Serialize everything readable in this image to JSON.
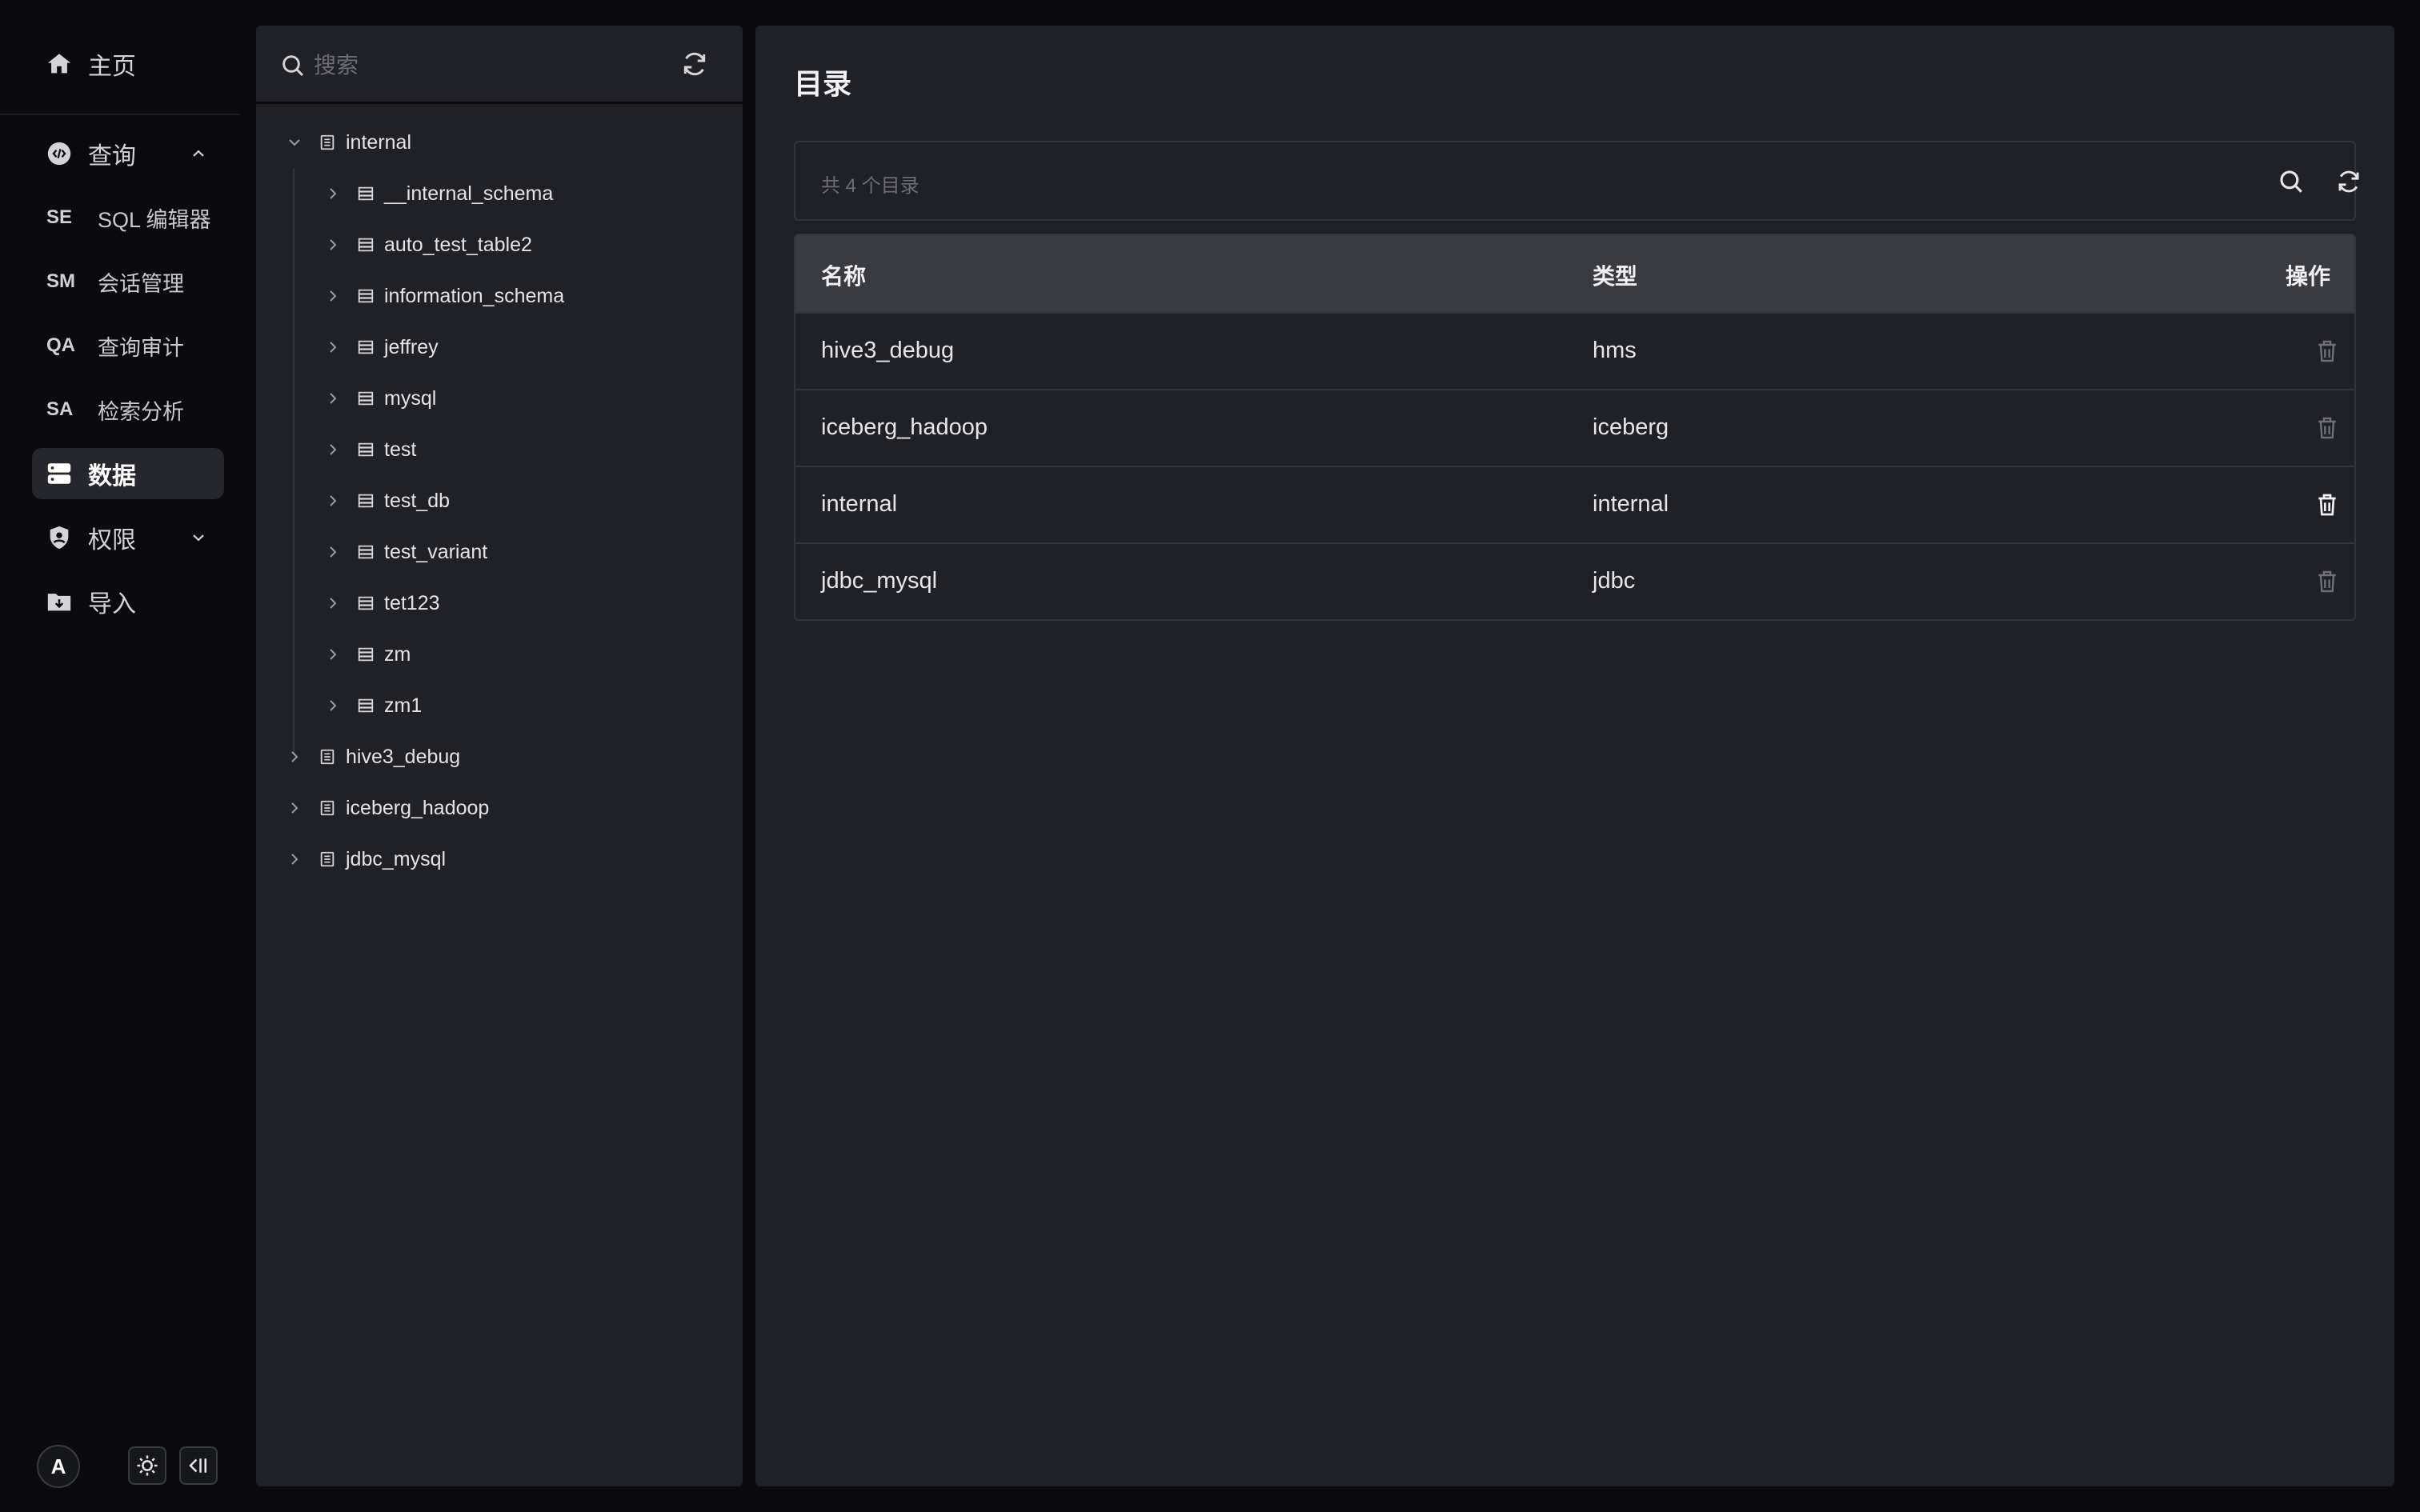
{
  "nav": {
    "home": "主页",
    "query": "查询",
    "query_sub": [
      {
        "abbr": "SE",
        "label": "SQL 编辑器"
      },
      {
        "abbr": "SM",
        "label": "会话管理"
      },
      {
        "abbr": "QA",
        "label": "查询审计"
      },
      {
        "abbr": "SA",
        "label": "检索分析"
      }
    ],
    "data": "数据",
    "permissions": "权限",
    "import": "导入",
    "avatar_initial": "A"
  },
  "tree": {
    "search_placeholder": "搜索",
    "catalogs": [
      {
        "name": "internal",
        "expanded": true,
        "databases": [
          "__internal_schema",
          "auto_test_table2",
          "information_schema",
          "jeffrey",
          "mysql",
          "test",
          "test_db",
          "test_variant",
          "tet123",
          "zm",
          "zm1"
        ]
      },
      {
        "name": "hive3_debug",
        "expanded": false
      },
      {
        "name": "iceberg_hadoop",
        "expanded": false
      },
      {
        "name": "jdbc_mysql",
        "expanded": false
      }
    ]
  },
  "main": {
    "title": "目录",
    "count_text": "共 4 个目录",
    "columns": {
      "name": "名称",
      "type": "类型",
      "actions": "操作"
    },
    "rows": [
      {
        "name": "hive3_debug",
        "type": "hms"
      },
      {
        "name": "iceberg_hadoop",
        "type": "iceberg"
      },
      {
        "name": "internal",
        "type": "internal"
      },
      {
        "name": "jdbc_mysql",
        "type": "jdbc"
      }
    ]
  },
  "colors": {
    "background": "#0b0b0f",
    "panel": "#202127",
    "header_row": "#3a3b41",
    "active_nav": "#26272d"
  }
}
